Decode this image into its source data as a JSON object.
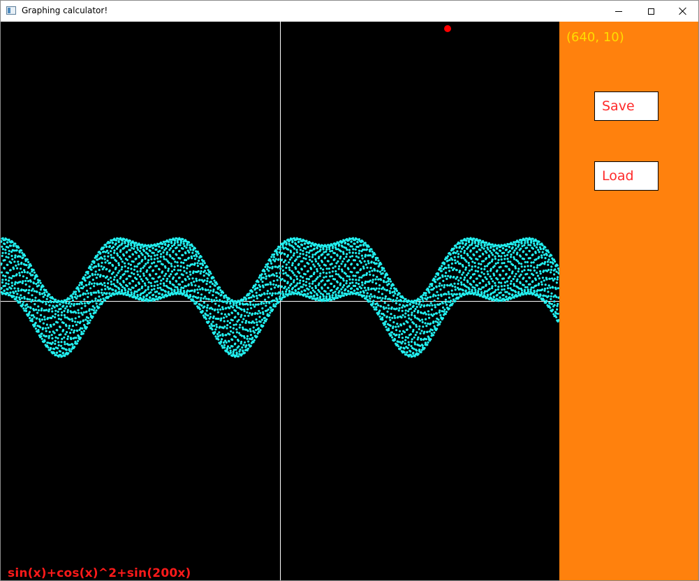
{
  "window": {
    "title": "Graphing calculator!",
    "icon": "app-window-icon",
    "controls": [
      "minimize-icon",
      "maximize-icon",
      "close-icon"
    ]
  },
  "graph": {
    "formula": "sin(x)+cos(x)^2+sin(200x)",
    "background_color": "#000000",
    "axis_color": "#ffffff",
    "curve_color": "#22f0f0",
    "cursor_dot_color": "#ff0000"
  },
  "chart_data": {
    "type": "scatter",
    "function": "sin(x)+cos(x)^2+sin(200x)",
    "xlim": [
      -10,
      10
    ],
    "ylim": [
      -10,
      10
    ],
    "grid": false
  },
  "panel": {
    "background_color": "#ff810d",
    "coords_text": "(640, 10)",
    "coords_color": "#ffdd00",
    "save_label": "Save",
    "load_label": "Load"
  }
}
